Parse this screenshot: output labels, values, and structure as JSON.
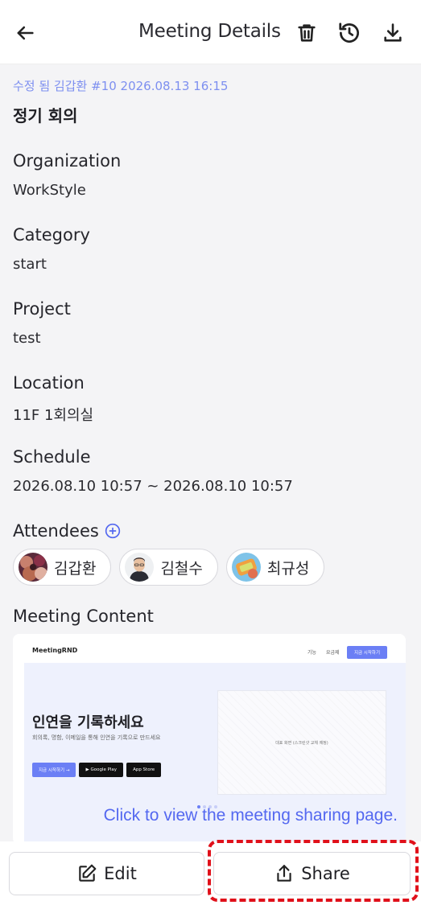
{
  "header": {
    "title": "Meeting Details",
    "back_icon": "arrow-left-icon",
    "actions": [
      "trash-icon",
      "history-icon",
      "download-icon"
    ]
  },
  "meeting": {
    "modified_info": "수정 됨 김갑환 #10 2026.08.13 16:15",
    "title": "정기 회의"
  },
  "fields": {
    "organization": {
      "label": "Organization",
      "value": "WorkStyle"
    },
    "category": {
      "label": "Category",
      "value": "start"
    },
    "project": {
      "label": "Project",
      "value": "test"
    },
    "location": {
      "label": "Location",
      "value": "11F 1회의실"
    },
    "schedule": {
      "label": "Schedule",
      "value": "2026.08.10 10:57 ~ 2026.08.10 10:57"
    }
  },
  "attendees": {
    "label": "Attendees",
    "people": [
      {
        "name": "김갑환"
      },
      {
        "name": "김철수"
      },
      {
        "name": "최규성"
      }
    ]
  },
  "meeting_content": {
    "label": "Meeting Content",
    "preview": {
      "logo": "MeetingRND",
      "menu": [
        "기능",
        "요금제"
      ],
      "nav_button": "지금 시작하기",
      "headline": "인연을 기록하세요",
      "subtext": "회의록, 명함, 이메일을 통해 인연을 기록으로 만드세요",
      "buttons": [
        "지금 시작하기 →",
        "▶ Google Play",
        " App Store"
      ],
      "screenshot_placeholder": "대표 화면 (스크린샷 교체 예정)"
    },
    "overlay_text": "Click to view the meeting sharing page."
  },
  "footer": {
    "edit_label": "Edit",
    "share_label": "Share"
  },
  "colors": {
    "accent": "#5468F0",
    "modified_text": "#7D8FF0",
    "highlight": "#E0101A",
    "background": "#F4F4F6"
  }
}
